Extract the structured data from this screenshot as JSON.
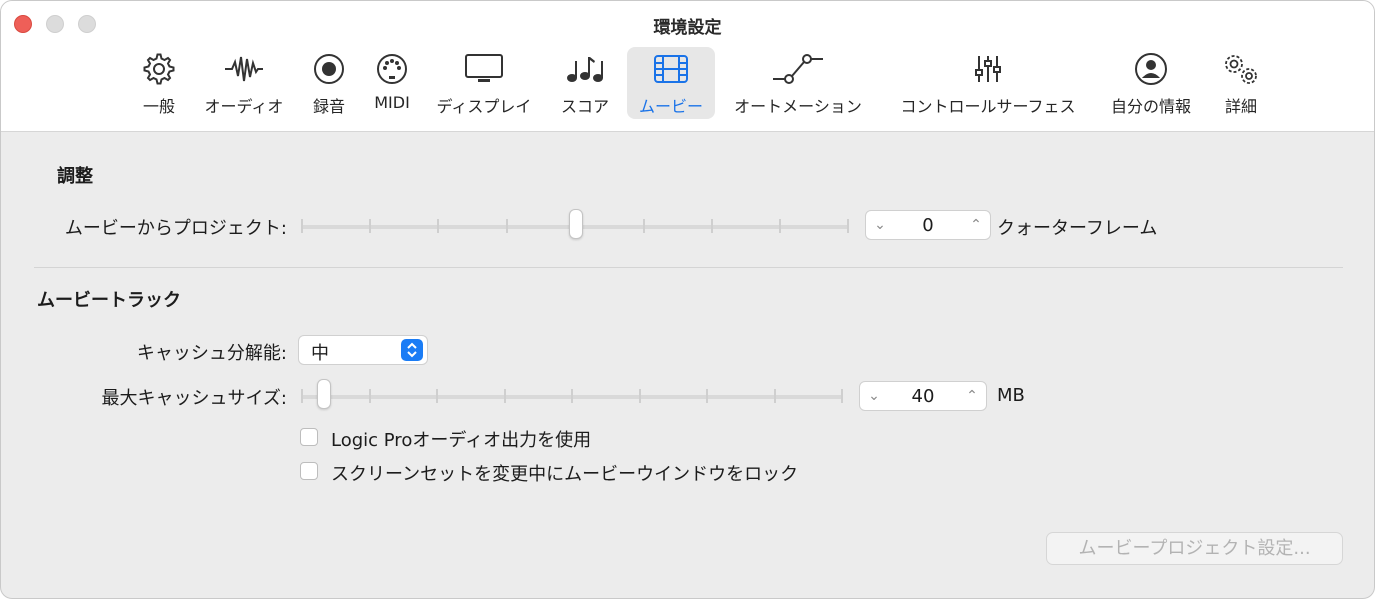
{
  "window": {
    "title": "環境設定"
  },
  "toolbar": {
    "items": [
      {
        "label": "一般",
        "icon": "gear-icon"
      },
      {
        "label": "オーディオ",
        "icon": "waveform-icon"
      },
      {
        "label": "録音",
        "icon": "record-icon"
      },
      {
        "label": "MIDI",
        "icon": "midi-port-icon"
      },
      {
        "label": "ディスプレイ",
        "icon": "monitor-icon"
      },
      {
        "label": "スコア",
        "icon": "music-notes-icon"
      },
      {
        "label": "ムービー",
        "icon": "film-icon",
        "active": true
      },
      {
        "label": "オートメーション",
        "icon": "automation-curve-icon"
      },
      {
        "label": "コントロールサーフェス",
        "icon": "faders-icon"
      },
      {
        "label": "自分の情報",
        "icon": "person-icon"
      },
      {
        "label": "詳細",
        "icon": "gears-icon"
      }
    ]
  },
  "adjust": {
    "section_title": "調整",
    "movie_to_project_label": "ムービーからプロジェクト:",
    "movie_to_project_value": "0",
    "movie_to_project_unit": "クォーターフレーム"
  },
  "movie_track": {
    "section_title": "ムービートラック",
    "cache_resolution_label": "キャッシュ分解能:",
    "cache_resolution_value": "中",
    "max_cache_size_label": "最大キャッシュサイズ:",
    "max_cache_size_value": "40",
    "max_cache_size_unit": "MB",
    "checkbox_logic_audio": "Logic Proオーディオ出力を使用",
    "checkbox_lock_window": "スクリーンセットを変更中にムービーウインドウをロック"
  },
  "footer": {
    "movie_project_settings_button": "ムービープロジェクト設定..."
  },
  "colors": {
    "accent": "#1a73e8",
    "close": "#ee5f58"
  }
}
